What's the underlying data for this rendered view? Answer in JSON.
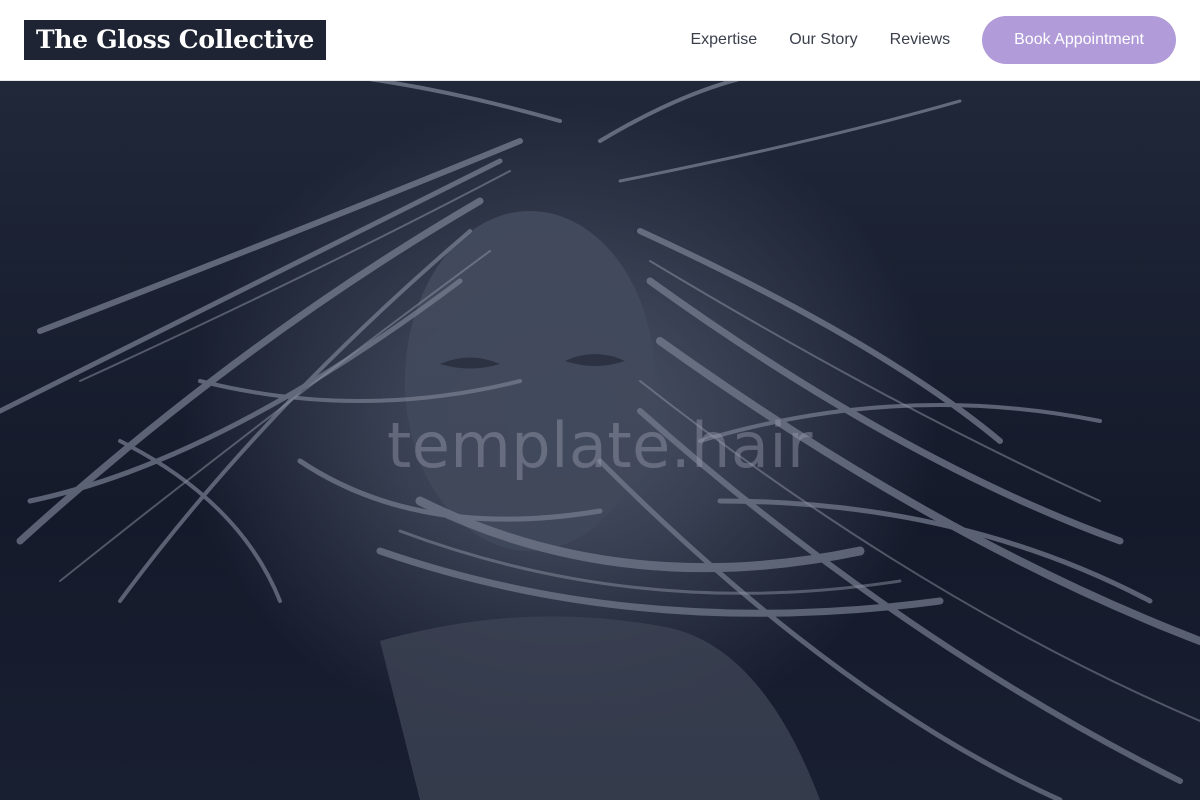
{
  "header": {
    "logo": "The Gloss Collective",
    "nav": [
      {
        "label": "Expertise"
      },
      {
        "label": "Our Story"
      },
      {
        "label": "Reviews"
      }
    ],
    "cta_label": "Book Appointment"
  },
  "hero": {
    "watermark": "template.hair"
  },
  "colors": {
    "accent": "#b19cd9",
    "logo_bg": "#1e2433",
    "hero_bg": "#1a1f2e"
  }
}
